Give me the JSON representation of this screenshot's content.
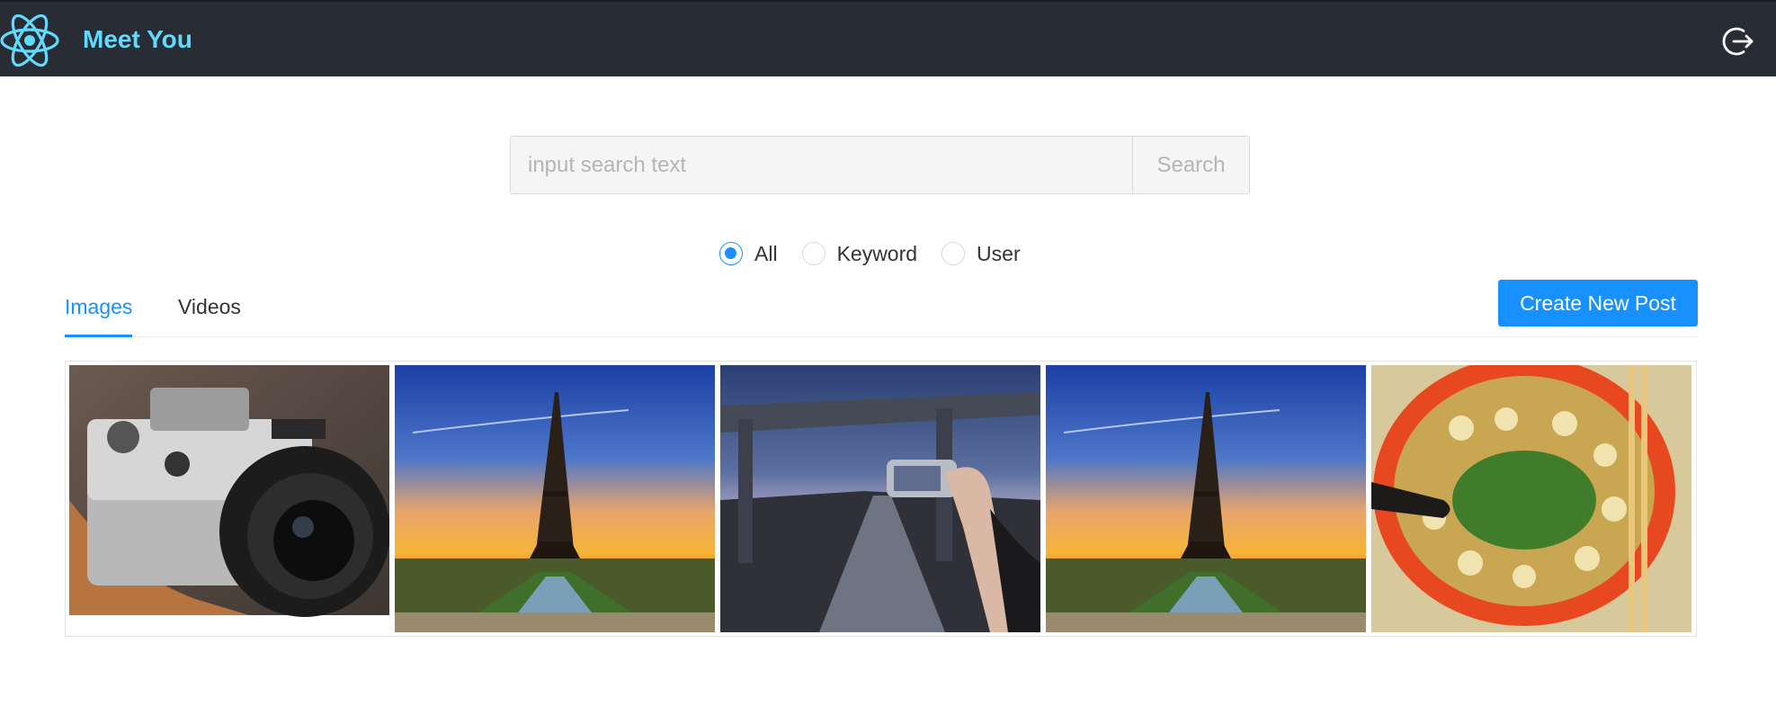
{
  "app": {
    "title": "Meet You",
    "logo_icon": "react-atom-icon",
    "logout_icon": "logout-icon",
    "brand_color": "#61dafb",
    "header_bg": "#282c34"
  },
  "search": {
    "placeholder": "input search text",
    "value": "",
    "button_label": "Search"
  },
  "search_type": {
    "options": [
      "All",
      "Keyword",
      "User"
    ],
    "selected": "All"
  },
  "tabs": {
    "items": [
      "Images",
      "Videos"
    ],
    "active": "Images"
  },
  "actions": {
    "create_post_label": "Create New Post",
    "accent": "#1890ff"
  },
  "gallery": {
    "items": [
      {
        "subject": "nikon-camera"
      },
      {
        "subject": "eiffel-tower-sunset"
      },
      {
        "subject": "bridge-phone-photo"
      },
      {
        "subject": "eiffel-tower-sunset"
      },
      {
        "subject": "noodle-soup-bowl"
      }
    ]
  }
}
